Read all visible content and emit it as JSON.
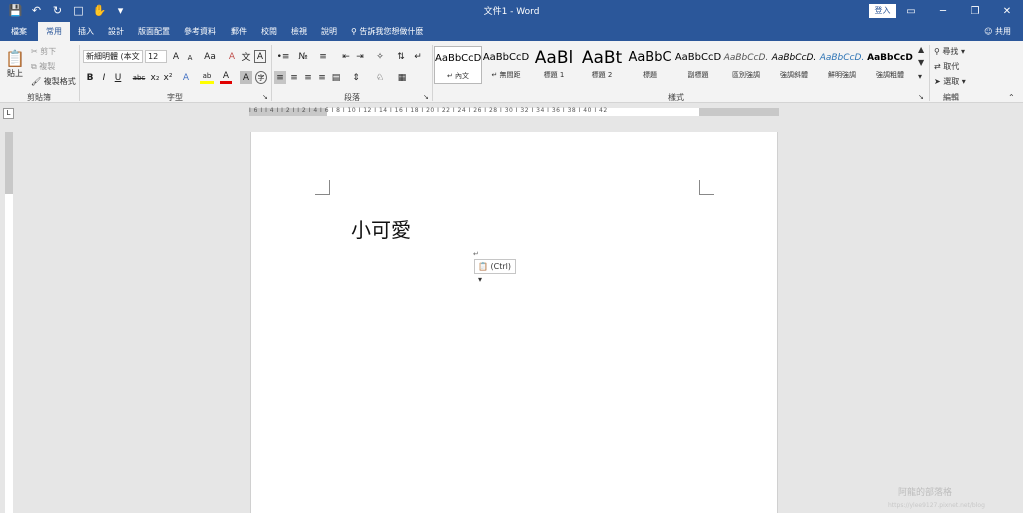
{
  "window": {
    "doc_title": "文件1 - Word",
    "signin": "登入",
    "buttons": [
      "▭",
      "─",
      "❐",
      "✕"
    ]
  },
  "qat": {
    "save_icon": "save-icon",
    "undo_icon": "undo-icon",
    "redo_icon": "redo-icon",
    "new_icon": "new-document-icon",
    "touch_icon": "touch-mode-icon",
    "customize": "▾"
  },
  "tabs": [
    "檔案",
    "常用",
    "插入",
    "設計",
    "版面配置",
    "參考資料",
    "郵件",
    "校閱",
    "檢視",
    "說明"
  ],
  "active_tab": "常用",
  "tellme": "告訴我您想做什麼",
  "share": "共用",
  "clipboard": {
    "paste": "貼上",
    "cut": "剪下",
    "copy": "複製",
    "format_painter": "複製格式",
    "label": "剪貼簿"
  },
  "font": {
    "name": "新細明體 (本文",
    "size": "12",
    "grow": "A",
    "shrink": "A",
    "case": "Aa",
    "clear": "A",
    "phonetic": "文",
    "border": "A",
    "bold": "B",
    "italic": "I",
    "underline": "U",
    "strike": "abc",
    "subscript": "x₂",
    "superscript": "x²",
    "effects": "A",
    "highlight": "ab",
    "color": "A",
    "char_shading": "A",
    "enclose": "字",
    "label": "字型"
  },
  "paragraph": {
    "label": "段落"
  },
  "styles": {
    "items": [
      {
        "preview": "AaBbCcD",
        "name": "↵ 內文"
      },
      {
        "preview": "AaBbCcD",
        "name": "↵ 無間距"
      },
      {
        "preview": "AaBl",
        "name": "標題 1"
      },
      {
        "preview": "AaBt",
        "name": "標題 2"
      },
      {
        "preview": "AaBbC",
        "name": "標題"
      },
      {
        "preview": "AaBbCcD",
        "name": "副標題"
      },
      {
        "preview": "AaBbCcD.",
        "name": "區別強調"
      },
      {
        "preview": "AaBbCcD.",
        "name": "強調斜體"
      },
      {
        "preview": "AaBbCcD.",
        "name": "鮮明強調"
      },
      {
        "preview": "AaBbCcD",
        "name": "強調粗體"
      }
    ],
    "label": "樣式"
  },
  "editing": {
    "find": "尋找",
    "replace": "取代",
    "select": "選取",
    "label": "編輯"
  },
  "ruler_numbers": "I 6 I I 4 I I 2 I   I 2 I 4 I 6 I 8 I 10 I 12 I 14 I 16 I 18 I 20 I 22 I 24 I 26 I 28 I 30 I 32 I 34 I 36 I 38 I 40 I 42",
  "document": {
    "text": "小可愛",
    "paste_options": "(Ctrl) ▾"
  },
  "watermark": {
    "line1": "阿龍的部落格",
    "line2": "https://ylee9127.pixnet.net/blog"
  },
  "colors": {
    "accent": "#2b579a",
    "ribbon_bg": "#f3f3f3"
  }
}
